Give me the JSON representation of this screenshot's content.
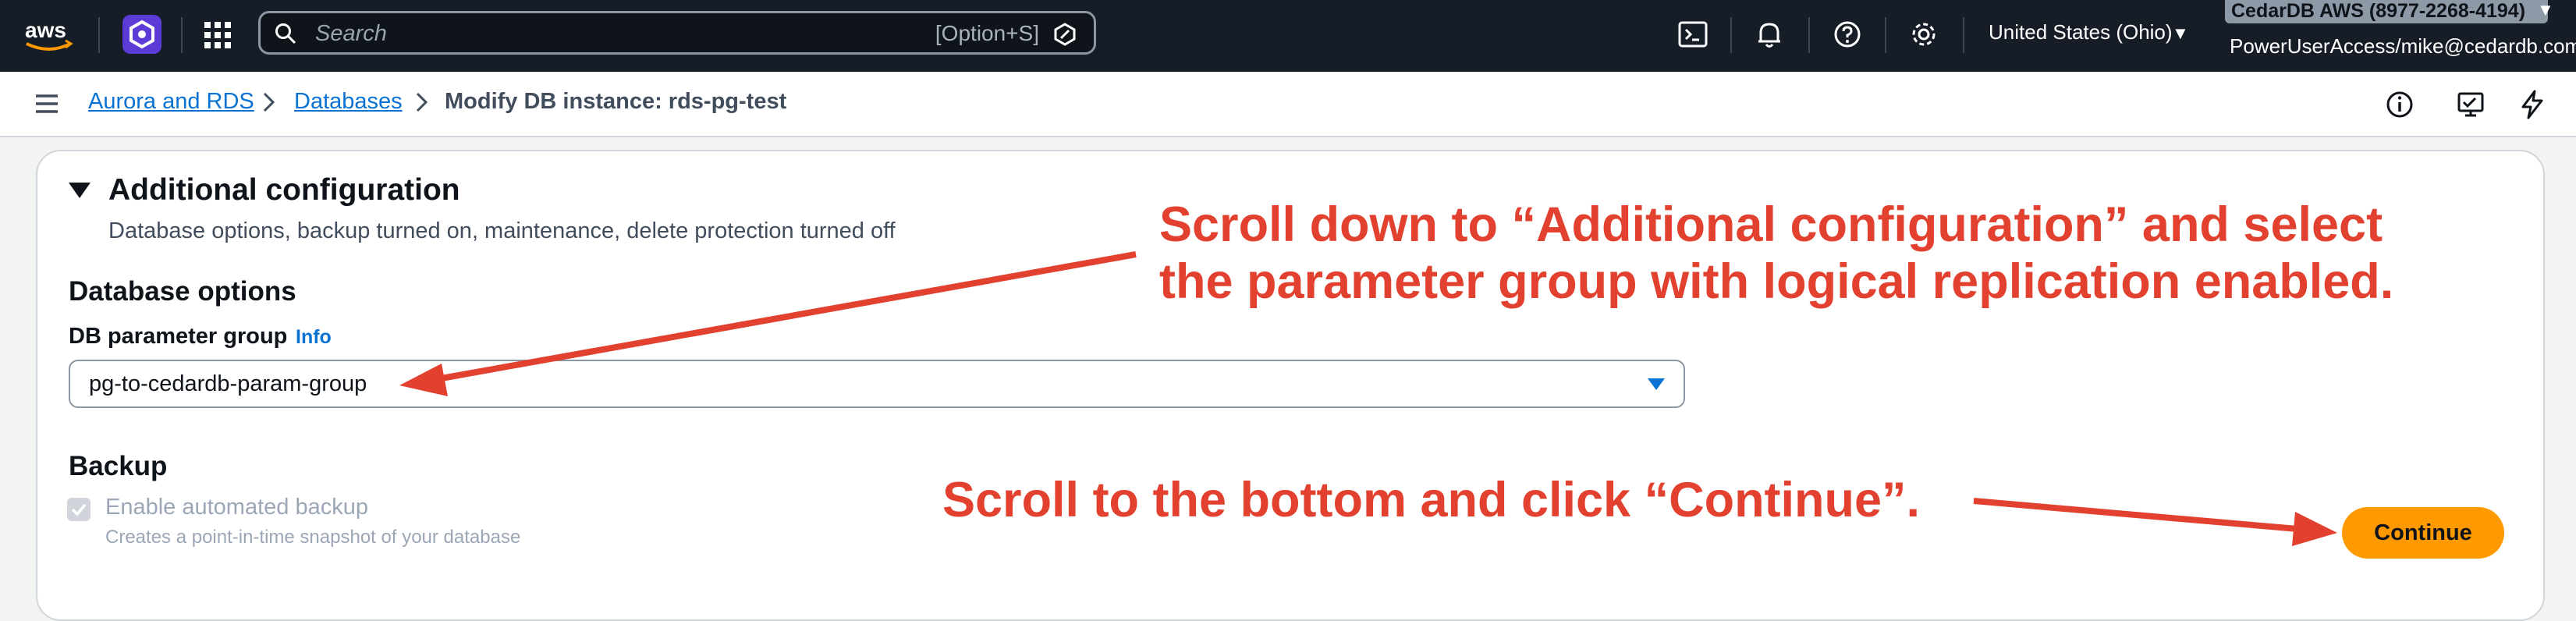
{
  "topnav": {
    "logo_icon": "aws-logo-icon",
    "search": {
      "placeholder": "Search",
      "shortcut": "[Option+S]"
    },
    "region": "United States (Ohio)",
    "account": "CedarDB AWS (8977-2268-4194)",
    "role": "PowerUserAccess/mike@cedardb.com"
  },
  "breadcrumb": {
    "items": [
      "Aurora and RDS",
      "Databases"
    ],
    "current": "Modify DB instance: rds-pg-test"
  },
  "section": {
    "title": "Additional configuration",
    "description": "Database options, backup turned on, maintenance, delete protection turned off"
  },
  "database_options": {
    "heading": "Database options",
    "param_group_label": "DB parameter group",
    "info_link": "Info",
    "param_group_value": "pg-to-cedardb-param-group"
  },
  "backup": {
    "heading": "Backup",
    "checkbox_label": "Enable automated backup",
    "checkbox_desc": "Creates a point-in-time snapshot of your database",
    "checked": true,
    "disabled": true
  },
  "actions": {
    "continue_label": "Continue"
  },
  "annotations": {
    "top_line1": "Scroll down to “Additional configuration” and select",
    "top_line2": "the parameter group with logical replication enabled.",
    "bottom": "Scroll to the bottom and click “Continue”.",
    "color": "#e2412f"
  },
  "colors": {
    "nav_bg": "#161d26",
    "link": "#0972d3",
    "primary_button": "#ff9900"
  }
}
